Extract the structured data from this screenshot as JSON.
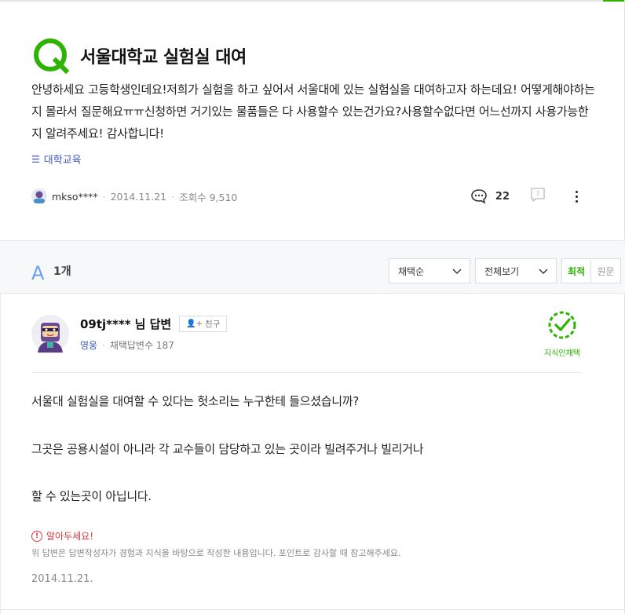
{
  "colors": {
    "brand": "#2db400",
    "tag": "#3d56c5",
    "answer_accent": "#6b9ef5",
    "warning": "#e0393e"
  },
  "question": {
    "title": "서울대학교 실험실 대여",
    "body": "안녕하세요 고등학생인데요!저희가 실험을 하고 싶어서 서울대에 있는 실험실을 대여하고자 하는데요! 어떻게해야하는지 몰라서 질문해요ㅠㅠ신청하면 거기있는 물품들은 다 사용할수 있는건가요?사용할수없다면 어느선까지 사용가능한지 알려주세요! 감사합니다!",
    "tag": "대학교육",
    "author": "mkso****",
    "date": "2014.11.21",
    "views_label": "조회수 9,510",
    "comment_count": "22"
  },
  "answers": {
    "count_label": "1개",
    "filter_sort": "채택순",
    "filter_view": "전체보기",
    "sort_latest": "최적",
    "sort_original": "원문"
  },
  "answer": {
    "username": "09tj****",
    "suffix": "님 답변",
    "friend_label": "친구",
    "rank": "영웅",
    "adopted_label": "채택답변수 187",
    "badge_label": "지식인채택",
    "lines": [
      "서울대 실험실을 대여할 수 있다는 헛소리는 누구한테 들으셨습니까?",
      "그곳은 공용시설이 아니라 각 교수들이 담당하고 있는 곳이라 빌려주거나 빌리거나",
      "할 수 있는곳이 아닙니다."
    ],
    "notice_title": "알아두세요!",
    "notice_text": "위 답변은 답변작성자가 경험과 지식을 바탕으로 작성한 내용입니다. 포인트로 감사할 때 참고해주세요.",
    "date": "2014.11.21."
  }
}
